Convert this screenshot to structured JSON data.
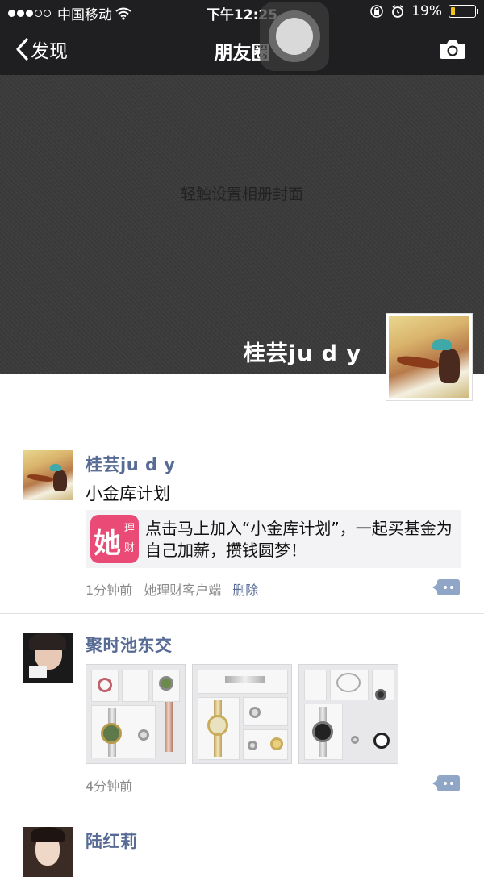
{
  "status_bar": {
    "carrier": "中国移动",
    "time": "下午12:25",
    "battery": "19%",
    "battery_level": 0.19,
    "battery_color": "#f0c419"
  },
  "nav": {
    "back_label": "发现",
    "title": "朋友圈",
    "camera_icon": "camera-icon"
  },
  "cover": {
    "hint": "轻触设置相册封面",
    "user_name": "桂芸ju d y"
  },
  "colors": {
    "link_blue": "#576b95",
    "nav_bg": "#1f1f21",
    "brand_pink": "#e94a76"
  },
  "posts": [
    {
      "name": "桂芸ju d y",
      "text": "小金库计划",
      "link": {
        "icon_char": "她",
        "icon_small_1": "理",
        "icon_small_2": "财",
        "text": "点击马上加入“小金库计划”，一起买基金为自己加薪，攒钱圆梦！"
      },
      "time": "1分钟前",
      "source": "她理财客户端",
      "delete": "删除"
    },
    {
      "name": "聚时池东交",
      "image_count": 3,
      "time": "4分钟前"
    },
    {
      "name": "陆红莉"
    }
  ]
}
